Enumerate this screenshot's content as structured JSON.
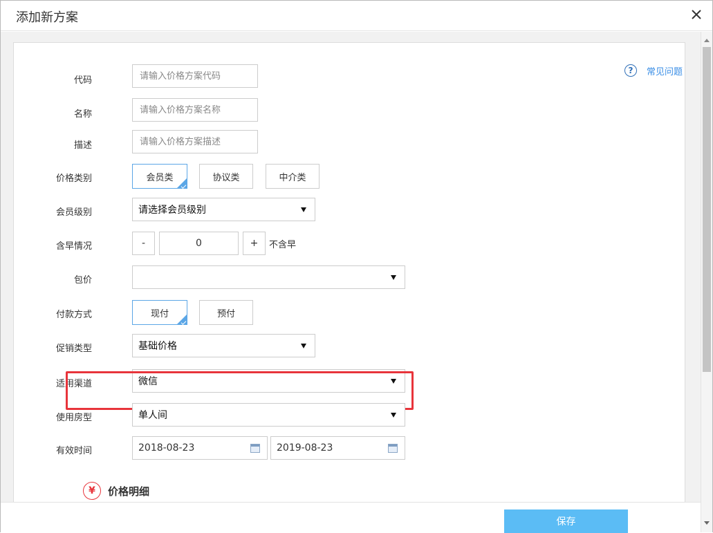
{
  "dialog": {
    "title": "添加新方案",
    "close_icon": "close-icon",
    "help_label": "常见问题",
    "help_icon": "question-circle-icon"
  },
  "form": {
    "code": {
      "label": "代码",
      "placeholder": "请输入价格方案代码",
      "value": ""
    },
    "name": {
      "label": "名称",
      "placeholder": "请输入价格方案名称",
      "value": ""
    },
    "description": {
      "label": "描述",
      "placeholder": "请输入价格方案描述",
      "value": ""
    },
    "price_category": {
      "label": "价格类别",
      "options": [
        "会员类",
        "协议类",
        "中介类"
      ],
      "selected": "会员类"
    },
    "member_level": {
      "label": "会员级别",
      "value": "请选择会员级别"
    },
    "breakfast": {
      "label": "含早情况",
      "minus": "-",
      "plus": "+",
      "value": "0",
      "note": "不含早"
    },
    "package_price": {
      "label": "包价",
      "value": ""
    },
    "payment_method": {
      "label": "付款方式",
      "options": [
        "现付",
        "预付"
      ],
      "selected": "现付"
    },
    "promotion_type": {
      "label": "促销类型",
      "value": "基础价格"
    },
    "channel": {
      "label": "适用渠道",
      "value": "微信",
      "highlight_color": "#e8343b"
    },
    "room_type": {
      "label": "使用房型",
      "value": "单人间"
    },
    "valid_period": {
      "label": "有效时间",
      "start": "2018-08-23",
      "end": "2019-08-23"
    }
  },
  "section": {
    "title": "价格明细",
    "icon": "yen-icon"
  },
  "footer": {
    "save_label": "保存",
    "save_color": "#5bbcf5"
  },
  "colors": {
    "accent": "#5ba6e6",
    "link": "#3a8ee6"
  }
}
